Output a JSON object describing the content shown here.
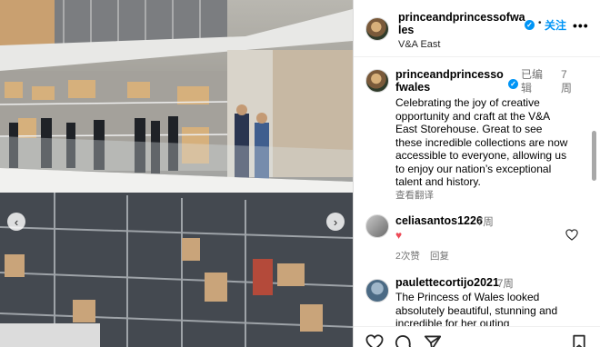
{
  "post": {
    "username": "princeandprincessofwales",
    "location": "V&A East",
    "follow_label": "关注",
    "more_label": "•••",
    "dot": "•",
    "verified_icon": "verified-badge-icon",
    "caption": {
      "username": "princeandprincessofwales",
      "edited": "已编辑",
      "time": "7周",
      "text": "Celebrating the joy of creative opportunity and craft at the V&A East Storehouse. Great to see these incredible collections are now accessible to everyone, allowing us to enjoy our nation’s exceptional talent and history.",
      "see_translation": "查看翻译"
    },
    "comments": [
      {
        "username": "celiasantos1226",
        "time": "7周",
        "text": "♥",
        "likes": "2次赞",
        "reply_label": "回复"
      },
      {
        "username": "paulettecortijo2021",
        "time": "7周",
        "text": "The Princess of Wales looked absolutely beautiful, stunning and incredible for her outing"
      }
    ]
  },
  "carousel": {
    "prev_label": "‹",
    "next_label": "›"
  },
  "colors": {
    "accent": "#0095f6",
    "heart": "#ed4956",
    "muted": "#737373"
  }
}
